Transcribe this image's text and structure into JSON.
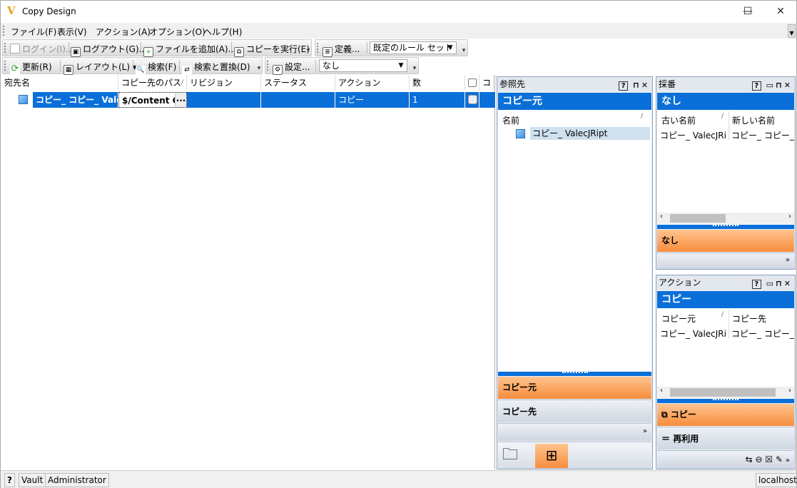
{
  "window": {
    "title": "Copy Design",
    "logo": "V",
    "minimize": "—",
    "maximize": "☐",
    "close": "✕"
  },
  "menu": [
    "ファイル(F)",
    "表示(V)",
    "アクション(A)",
    "オプション(O)",
    "ヘルプ(H)"
  ],
  "toolbar1": {
    "login": "ログイン(I)...",
    "logout": "ログアウト(G)...",
    "add_file": "ファイルを追加(A)...",
    "run_copy": "コピーを実行(E)",
    "define": "定義...",
    "ruleset": "既定のルール セット"
  },
  "toolbar2": {
    "refresh": "更新(R)",
    "layout": "レイアウト(L)",
    "search": "検索(F)",
    "search_replace": "検索と置換(D)",
    "settings": "設定...",
    "filter": "なし"
  },
  "grid": {
    "headers": [
      "宛先名",
      "コピー先のパス",
      "リビジョン",
      "ステータス",
      "アクション",
      "数",
      "コ"
    ],
    "row": {
      "name": "コピー_ コピー_ ValecJ...",
      "path": "$/Content C...",
      "more": "...",
      "revision": "",
      "status": "",
      "action": "コピー",
      "count": "1"
    }
  },
  "ref_panel": {
    "title": "参照先",
    "blue": "コピー元",
    "col_name": "名前",
    "item": "コピー_ ValecJRipt",
    "orange": "コピー元",
    "grey": "コピー先"
  },
  "numbering": {
    "title": "採番",
    "blue": "なし",
    "col_old": "古い名前",
    "col_new": "新しい名前",
    "old": "コピー_ ValecJRipt",
    "new": "コピー_ コピー_ Val...",
    "orange": "なし"
  },
  "action_panel": {
    "title": "アクション",
    "blue": "コピー",
    "col_src": "コピー元",
    "col_dst": "コピー先",
    "src": "コピー_ ValecJRipt",
    "dst": "コピー_ コピー_ Val...",
    "orange": "コピー",
    "grey": "再利用"
  },
  "status": {
    "help": "?",
    "vault": "Vault",
    "user": "Administrator",
    "server": "localhost"
  }
}
